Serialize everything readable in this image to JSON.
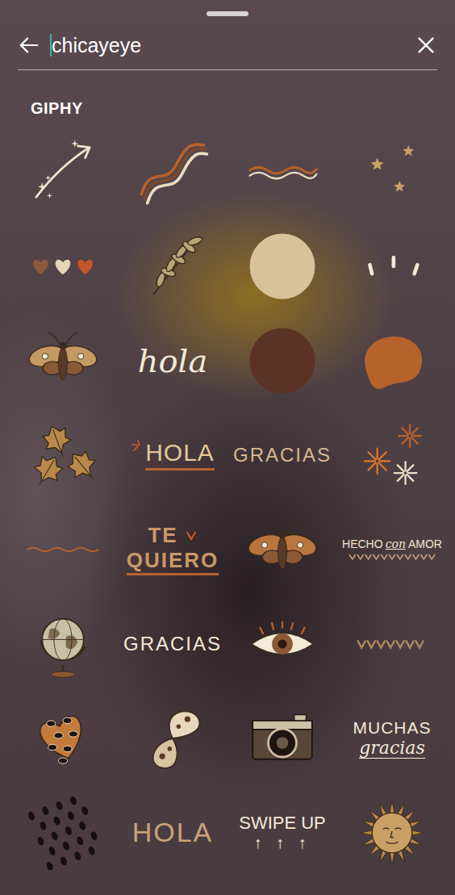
{
  "search": {
    "query": "chicayeye"
  },
  "section": {
    "label": "GIPHY"
  },
  "stickers": [
    {
      "kind": "arrow"
    },
    {
      "kind": "stripes"
    },
    {
      "kind": "wave"
    },
    {
      "kind": "stars"
    },
    {
      "kind": "hearts"
    },
    {
      "kind": "branch"
    },
    {
      "kind": "circle",
      "color": "#d8c29a"
    },
    {
      "kind": "dashes"
    },
    {
      "kind": "moth",
      "color": "#c49a62"
    },
    {
      "kind": "script",
      "text": "hola",
      "color": "#f3ead8"
    },
    {
      "kind": "circle",
      "color": "#5a3326"
    },
    {
      "kind": "blob",
      "color": "#b5622c"
    },
    {
      "kind": "leaves"
    },
    {
      "kind": "rays",
      "text": "HOLA",
      "color": "#e4c79a"
    },
    {
      "kind": "caps",
      "text": "GRACIAS",
      "color": "#d9b88e"
    },
    {
      "kind": "starburst"
    },
    {
      "kind": "squiggle"
    },
    {
      "kind": "stacked",
      "lines": [
        "TE",
        "QUIERO"
      ],
      "color": "#c9996a"
    },
    {
      "kind": "moth",
      "color": "#b8763e"
    },
    {
      "kind": "signed",
      "words": [
        "HECHO",
        "con",
        "AMOR"
      ]
    },
    {
      "kind": "globe"
    },
    {
      "kind": "caps",
      "text": "GRACIAS",
      "color": "#f3ead8"
    },
    {
      "kind": "eye"
    },
    {
      "kind": "heartrow"
    },
    {
      "kind": "leopard"
    },
    {
      "kind": "wing"
    },
    {
      "kind": "camera"
    },
    {
      "kind": "muchas",
      "lines": [
        "MUCHAS",
        "gracias"
      ]
    },
    {
      "kind": "dots"
    },
    {
      "kind": "caps",
      "text": "HOLA",
      "color": "#c9a27a"
    },
    {
      "kind": "swipe",
      "text": "SWIPE UP",
      "arrows": "↑ ↑ ↑"
    },
    {
      "kind": "sun"
    }
  ]
}
